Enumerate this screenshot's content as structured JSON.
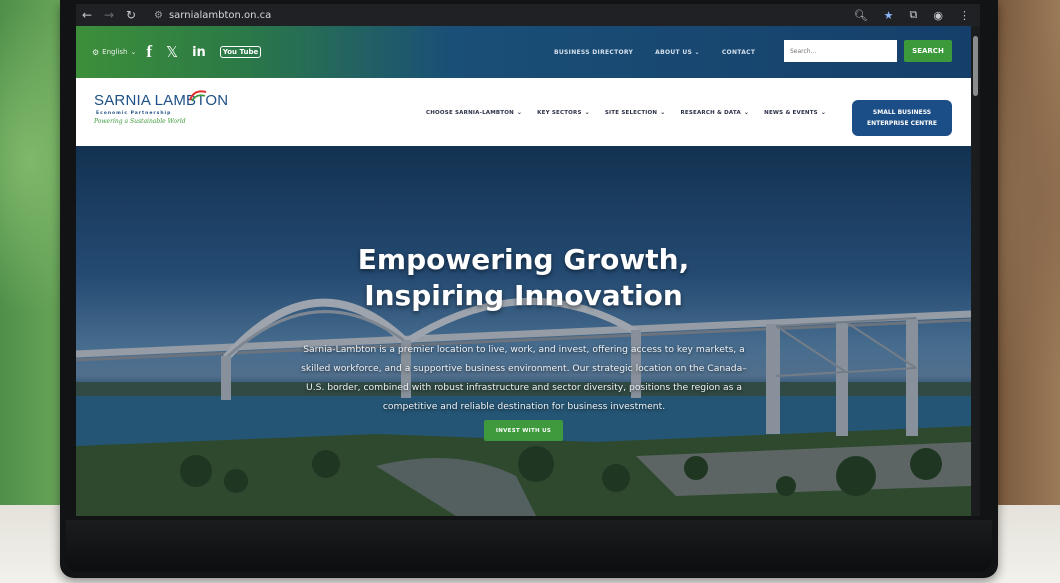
{
  "browser": {
    "url": "sarnialambton.on.ca",
    "icons": [
      "back-icon",
      "forward-icon",
      "reload-icon",
      "site-info-icon",
      "zoom-icon",
      "star-icon",
      "extensions-icon",
      "profile-icon",
      "menu-icon"
    ]
  },
  "utility_bar": {
    "language": "English",
    "social": {
      "facebook": "f",
      "x": "𝕏",
      "linkedin": "in",
      "youtube": "You Tube"
    },
    "links": [
      "BUSINESS DIRECTORY",
      "ABOUT US",
      "CONTACT"
    ],
    "search_placeholder": "Search...",
    "search_button": "SEARCH"
  },
  "header": {
    "logo_name": "SARNIA LAMBTON",
    "logo_sub": "Economic Partnership",
    "logo_tagline": "Powering a Sustainable World",
    "nav": [
      "CHOOSE SARNIA-LAMBTON",
      "KEY SECTORS",
      "SITE SELECTION",
      "RESEARCH & DATA",
      "NEWS & EVENTS"
    ],
    "cta_line1": "SMALL BUSINESS",
    "cta_line2": "ENTERPRISE CENTRE"
  },
  "hero": {
    "title_line1": "Empowering Growth,",
    "title_line2": "Inspiring Innovation",
    "body": "Sarnia-Lambton is a premier location to live, work, and invest, offering access to key markets, a skilled workforce, and a supportive business environment. Our strategic location on the Canada–U.S. border, combined with robust infrastructure and sector diversity, positions the region as a competitive and reliable destination for business investment.",
    "cta": "INVEST WITH US"
  },
  "colors": {
    "brand_green": "#3e9a3c",
    "brand_blue": "#1b4d86",
    "nav_text": "#2a2f45"
  }
}
